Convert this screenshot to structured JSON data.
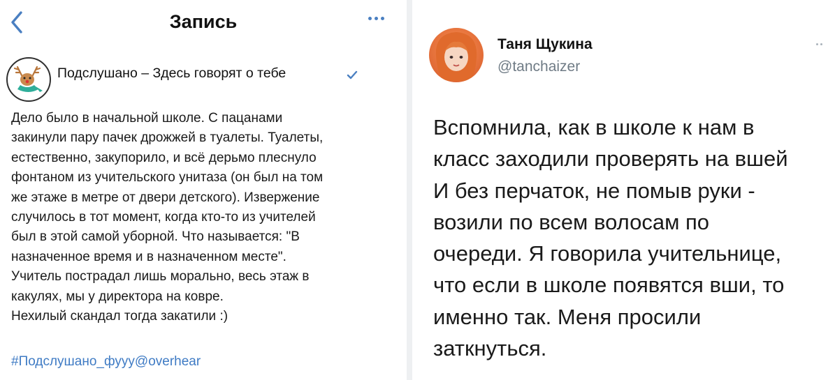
{
  "left_post": {
    "header": {
      "title": "Запись",
      "back_icon": "chevron-left-icon",
      "more_icon": "ellipsis-icon"
    },
    "group": {
      "name": "Подслушано – Здесь говорят о тебе",
      "avatar_icon": "reindeer-logo-icon",
      "verified_icon": "verified-check-icon"
    },
    "text_lines": [
      "Дело было в начальной школе. С пацанами",
      "закинули пару пачек дрожжей в туалеты. Туалеты,",
      "естественно, закупорило, и всё дерьмо плеснуло",
      "фонтаном из учительского унитаза (он был на том",
      "же этаже в метре от двери детского). Извержение",
      "случилось в тот момент, когда кто-то из учителей",
      "был в этой самой уборной. Что называется: \"В",
      "назначенное время и в назначенном месте\".",
      "Учитель пострадал лишь морально, весь этаж в",
      "какулях, мы у директора на ковре.",
      "Нехилый скандал тогда закатили :)"
    ],
    "hashtag": "#Подслушано_фууу@overhear",
    "colors": {
      "link": "#3f7bc4",
      "accent": "#4a7fc1"
    }
  },
  "right_tweet": {
    "user": {
      "display_name": "Таня Щукина",
      "handle": "@tanchaizer",
      "avatar_icon": "user-avatar-icon"
    },
    "text_lines": [
      "Вспомнила, как в школе к нам в",
      "класс заходили проверять на вшей",
      "И без перчаток, не помыв руки -",
      "возили по всем волосам по",
      "очереди. Я говорила учительнице,",
      "что если в школе появятся вши, то",
      "именно так. Меня просили",
      "заткнуться."
    ],
    "colors": {
      "handle": "#6f7b85"
    }
  }
}
